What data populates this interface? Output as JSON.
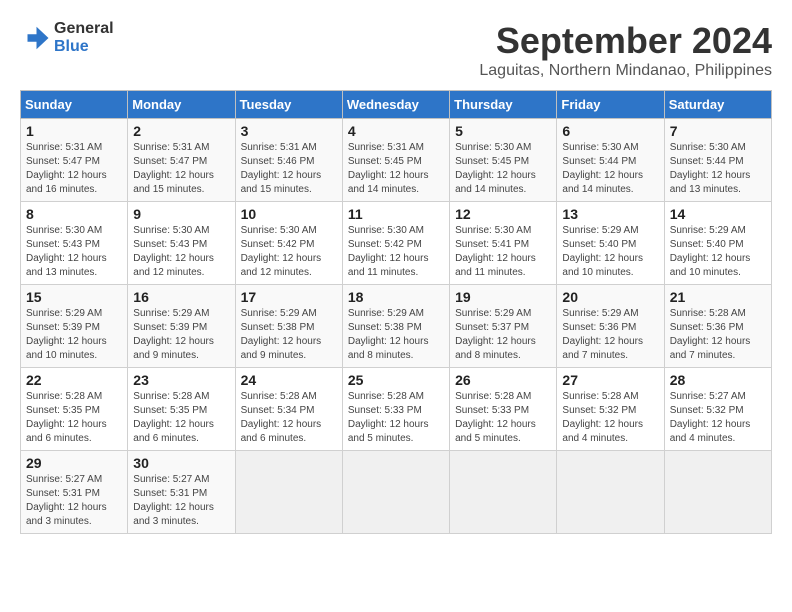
{
  "header": {
    "logo_line1": "General",
    "logo_line2": "Blue",
    "month": "September 2024",
    "location": "Laguitas, Northern Mindanao, Philippines"
  },
  "weekdays": [
    "Sunday",
    "Monday",
    "Tuesday",
    "Wednesday",
    "Thursday",
    "Friday",
    "Saturday"
  ],
  "days": [
    {
      "date": "",
      "info": ""
    },
    {
      "date": "",
      "info": ""
    },
    {
      "date": "",
      "info": ""
    },
    {
      "date": "",
      "info": ""
    },
    {
      "date": "",
      "info": ""
    },
    {
      "date": "",
      "info": ""
    },
    {
      "date": "1",
      "sunrise": "Sunrise: 5:31 AM",
      "sunset": "Sunset: 5:47 PM",
      "daylight": "Daylight: 12 hours and 16 minutes."
    },
    {
      "date": "2",
      "sunrise": "Sunrise: 5:31 AM",
      "sunset": "Sunset: 5:47 PM",
      "daylight": "Daylight: 12 hours and 15 minutes."
    },
    {
      "date": "3",
      "sunrise": "Sunrise: 5:31 AM",
      "sunset": "Sunset: 5:46 PM",
      "daylight": "Daylight: 12 hours and 15 minutes."
    },
    {
      "date": "4",
      "sunrise": "Sunrise: 5:31 AM",
      "sunset": "Sunset: 5:45 PM",
      "daylight": "Daylight: 12 hours and 14 minutes."
    },
    {
      "date": "5",
      "sunrise": "Sunrise: 5:30 AM",
      "sunset": "Sunset: 5:45 PM",
      "daylight": "Daylight: 12 hours and 14 minutes."
    },
    {
      "date": "6",
      "sunrise": "Sunrise: 5:30 AM",
      "sunset": "Sunset: 5:44 PM",
      "daylight": "Daylight: 12 hours and 14 minutes."
    },
    {
      "date": "7",
      "sunrise": "Sunrise: 5:30 AM",
      "sunset": "Sunset: 5:44 PM",
      "daylight": "Daylight: 12 hours and 13 minutes."
    },
    {
      "date": "8",
      "sunrise": "Sunrise: 5:30 AM",
      "sunset": "Sunset: 5:43 PM",
      "daylight": "Daylight: 12 hours and 13 minutes."
    },
    {
      "date": "9",
      "sunrise": "Sunrise: 5:30 AM",
      "sunset": "Sunset: 5:43 PM",
      "daylight": "Daylight: 12 hours and 12 minutes."
    },
    {
      "date": "10",
      "sunrise": "Sunrise: 5:30 AM",
      "sunset": "Sunset: 5:42 PM",
      "daylight": "Daylight: 12 hours and 12 minutes."
    },
    {
      "date": "11",
      "sunrise": "Sunrise: 5:30 AM",
      "sunset": "Sunset: 5:42 PM",
      "daylight": "Daylight: 12 hours and 11 minutes."
    },
    {
      "date": "12",
      "sunrise": "Sunrise: 5:30 AM",
      "sunset": "Sunset: 5:41 PM",
      "daylight": "Daylight: 12 hours and 11 minutes."
    },
    {
      "date": "13",
      "sunrise": "Sunrise: 5:29 AM",
      "sunset": "Sunset: 5:40 PM",
      "daylight": "Daylight: 12 hours and 10 minutes."
    },
    {
      "date": "14",
      "sunrise": "Sunrise: 5:29 AM",
      "sunset": "Sunset: 5:40 PM",
      "daylight": "Daylight: 12 hours and 10 minutes."
    },
    {
      "date": "15",
      "sunrise": "Sunrise: 5:29 AM",
      "sunset": "Sunset: 5:39 PM",
      "daylight": "Daylight: 12 hours and 10 minutes."
    },
    {
      "date": "16",
      "sunrise": "Sunrise: 5:29 AM",
      "sunset": "Sunset: 5:39 PM",
      "daylight": "Daylight: 12 hours and 9 minutes."
    },
    {
      "date": "17",
      "sunrise": "Sunrise: 5:29 AM",
      "sunset": "Sunset: 5:38 PM",
      "daylight": "Daylight: 12 hours and 9 minutes."
    },
    {
      "date": "18",
      "sunrise": "Sunrise: 5:29 AM",
      "sunset": "Sunset: 5:38 PM",
      "daylight": "Daylight: 12 hours and 8 minutes."
    },
    {
      "date": "19",
      "sunrise": "Sunrise: 5:29 AM",
      "sunset": "Sunset: 5:37 PM",
      "daylight": "Daylight: 12 hours and 8 minutes."
    },
    {
      "date": "20",
      "sunrise": "Sunrise: 5:29 AM",
      "sunset": "Sunset: 5:36 PM",
      "daylight": "Daylight: 12 hours and 7 minutes."
    },
    {
      "date": "21",
      "sunrise": "Sunrise: 5:28 AM",
      "sunset": "Sunset: 5:36 PM",
      "daylight": "Daylight: 12 hours and 7 minutes."
    },
    {
      "date": "22",
      "sunrise": "Sunrise: 5:28 AM",
      "sunset": "Sunset: 5:35 PM",
      "daylight": "Daylight: 12 hours and 6 minutes."
    },
    {
      "date": "23",
      "sunrise": "Sunrise: 5:28 AM",
      "sunset": "Sunset: 5:35 PM",
      "daylight": "Daylight: 12 hours and 6 minutes."
    },
    {
      "date": "24",
      "sunrise": "Sunrise: 5:28 AM",
      "sunset": "Sunset: 5:34 PM",
      "daylight": "Daylight: 12 hours and 6 minutes."
    },
    {
      "date": "25",
      "sunrise": "Sunrise: 5:28 AM",
      "sunset": "Sunset: 5:33 PM",
      "daylight": "Daylight: 12 hours and 5 minutes."
    },
    {
      "date": "26",
      "sunrise": "Sunrise: 5:28 AM",
      "sunset": "Sunset: 5:33 PM",
      "daylight": "Daylight: 12 hours and 5 minutes."
    },
    {
      "date": "27",
      "sunrise": "Sunrise: 5:28 AM",
      "sunset": "Sunset: 5:32 PM",
      "daylight": "Daylight: 12 hours and 4 minutes."
    },
    {
      "date": "28",
      "sunrise": "Sunrise: 5:27 AM",
      "sunset": "Sunset: 5:32 PM",
      "daylight": "Daylight: 12 hours and 4 minutes."
    },
    {
      "date": "29",
      "sunrise": "Sunrise: 5:27 AM",
      "sunset": "Sunset: 5:31 PM",
      "daylight": "Daylight: 12 hours and 3 minutes."
    },
    {
      "date": "30",
      "sunrise": "Sunrise: 5:27 AM",
      "sunset": "Sunset: 5:31 PM",
      "daylight": "Daylight: 12 hours and 3 minutes."
    },
    {
      "date": "",
      "info": ""
    },
    {
      "date": "",
      "info": ""
    },
    {
      "date": "",
      "info": ""
    },
    {
      "date": "",
      "info": ""
    },
    {
      "date": "",
      "info": ""
    }
  ]
}
